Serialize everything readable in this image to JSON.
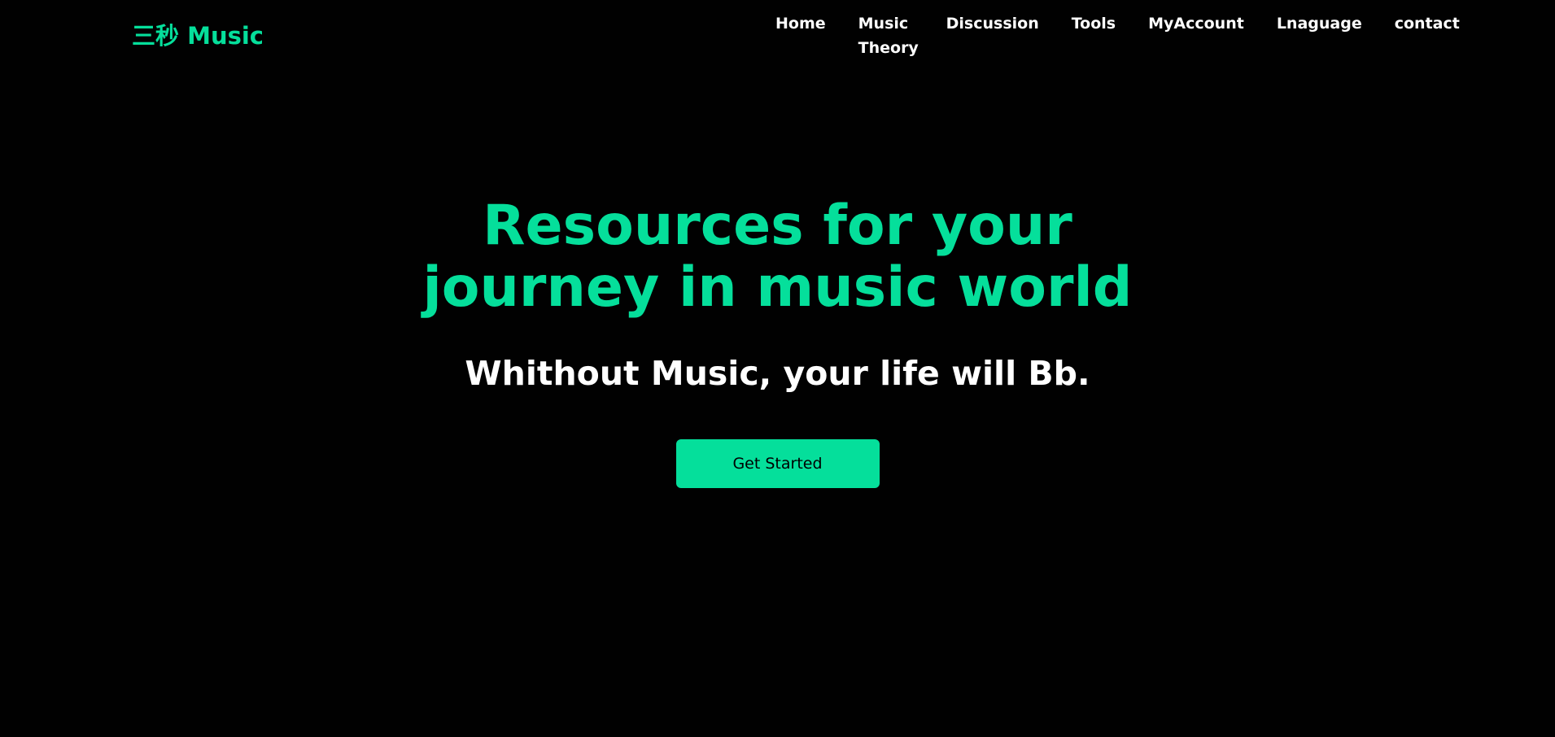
{
  "brand": {
    "logo_text": "三秒 Music",
    "accent_color": "#05df9b"
  },
  "nav": {
    "items": [
      {
        "label": "Home"
      },
      {
        "label": "Music Theory"
      },
      {
        "label": "Discussion"
      },
      {
        "label": "Tools"
      },
      {
        "label": "MyAccount"
      },
      {
        "label": "Lnaguage"
      },
      {
        "label": "contact"
      }
    ]
  },
  "hero": {
    "title": "Resources for your journey in music world",
    "subtitle": "Whithout Music, your life will Bb.",
    "cta_label": "Get Started"
  },
  "colors": {
    "background": "#010101",
    "text": "#ffffff",
    "button_text": "#000000"
  }
}
